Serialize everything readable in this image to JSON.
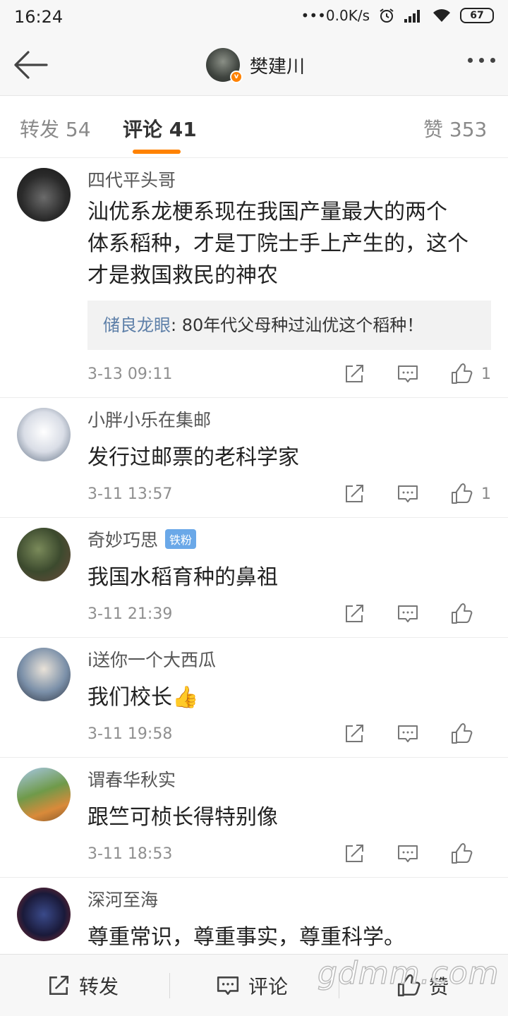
{
  "status": {
    "time": "16:24",
    "network_speed": "•••0.0K/s",
    "battery": "67"
  },
  "header": {
    "title": "樊建川"
  },
  "tabs": [
    {
      "label": "转发 54"
    },
    {
      "label": "评论 41"
    },
    {
      "label": "赞 353"
    }
  ],
  "comments": [
    {
      "user": "四代平头哥",
      "text_lines": [
        "汕优系龙梗系现在我国产量最大的两个",
        "体系稻种，才是丁院士手上产生的，这个",
        "才是救国救民的神农"
      ],
      "reply_user": "储良龙眼",
      "reply_text": ": 80年代父母种过汕优这个稻种！",
      "time": "3-13 09:11",
      "likes": "1"
    },
    {
      "user": "小胖小乐在集邮",
      "text_lines": [
        "发行过邮票的老科学家"
      ],
      "time": "3-11 13:57",
      "likes": "1"
    },
    {
      "user": "奇妙巧思",
      "badge": "铁粉",
      "text_lines": [
        "我国水稻育种的鼻祖"
      ],
      "time": "3-11 21:39",
      "likes": ""
    },
    {
      "user": "i送你一个大西瓜",
      "text_lines": [
        "我们校长👍"
      ],
      "time": "3-11 19:58",
      "likes": ""
    },
    {
      "user": "谓春华秋实",
      "text_lines": [
        "跟竺可桢长得特别像"
      ],
      "time": "3-11 18:53",
      "likes": ""
    },
    {
      "user": "深河至海",
      "text_lines": [
        "尊重常识，尊重事实，尊重科学。"
      ],
      "time": "",
      "likes": ""
    }
  ],
  "bottom_bar": {
    "repost": "转发",
    "comment": "评论",
    "like": "赞"
  },
  "watermark": "gdmm.com",
  "colors": {
    "accent": "#ff8200",
    "reply_user": "#5d7fa8",
    "fan_badge": "#6aa8e8"
  }
}
